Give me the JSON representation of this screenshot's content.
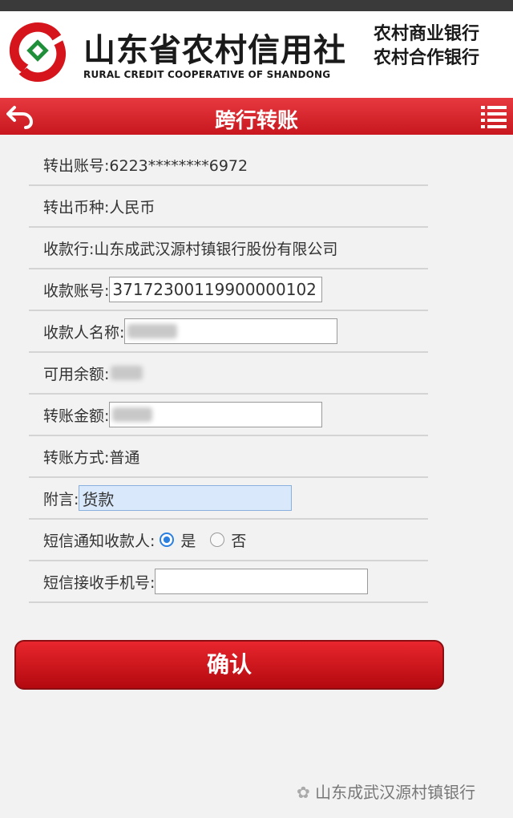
{
  "brand": {
    "name_cn": "山东省农村信用社",
    "name_en": "RURAL CREDIT COOPERATIVE OF SHANDONG",
    "side_line1": "农村商业银行",
    "side_line2": "农村合作银行"
  },
  "header": {
    "title": "跨行转账"
  },
  "form": {
    "from_account": "转出账号:6223********6972",
    "currency": "转出币种:人民币",
    "payee_bank": "收款行:山东成武汉源村镇银行股份有限公司",
    "payee_account_label": "收款账号:",
    "payee_account_value": "37172300119900000102",
    "payee_name_label": "收款人名称:",
    "balance_label": "可用余额:",
    "amount_label": "转账金额:",
    "method": "转账方式:普通",
    "memo_label": "附言:",
    "memo_value": "货款",
    "sms_label": "短信通知收款人:",
    "sms_yes": "是",
    "sms_no": "否",
    "sms_selected": "是",
    "phone_label": "短信接收手机号:",
    "phone_value": ""
  },
  "confirm_label": "确认",
  "watermark": "山东成武汉源村镇银行",
  "colors": {
    "brand_red": "#d6141b",
    "radio_blue": "#2a7fe0"
  }
}
